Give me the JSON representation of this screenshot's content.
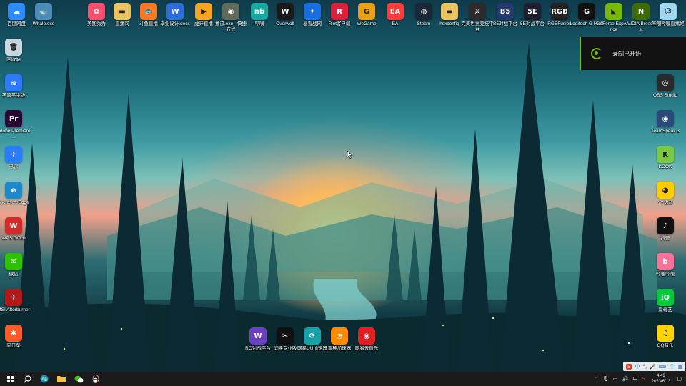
{
  "notification": {
    "text": "录制已开始"
  },
  "tray": {
    "ime_indicator": "中",
    "time": "4:49",
    "date": "2023/6/13"
  },
  "ime_toolbar": {
    "logo": "S",
    "mode": "中"
  },
  "taskbar": {
    "apps": [
      "start",
      "search",
      "edge",
      "file-explorer",
      "wechat",
      "qq"
    ]
  },
  "desktop": {
    "top_row": [
      {
        "label": "百度网盘",
        "icon": "baidu-netdisk-icon",
        "color": "#2f8cff",
        "glyph": "☁"
      },
      {
        "label": "Whale.exe",
        "icon": "whale-icon",
        "color": "#4a8bb8",
        "glyph": "🐋"
      },
      {
        "label": "美图秀秀",
        "icon": "meitu-icon",
        "color": "#ff4d6d",
        "glyph": "✿"
      },
      {
        "label": "直播间",
        "icon": "folder-icon",
        "color": "#e9c463",
        "glyph": "▬"
      },
      {
        "label": "斗鱼直播",
        "icon": "douyu-icon",
        "color": "#ff7a22",
        "glyph": "🐟"
      },
      {
        "label": "毕业设计.docx",
        "icon": "word-doc-icon",
        "color": "#2b6dd6",
        "glyph": "W"
      },
      {
        "label": "虎牙直播",
        "icon": "huya-icon",
        "color": "#f7a520",
        "glyph": "▶"
      },
      {
        "label": "播流.exe - 快捷方式",
        "icon": "app-exe-icon",
        "color": "#5f6a5a",
        "glyph": "◉"
      },
      {
        "label": "哔嘀",
        "icon": "bidi-icon",
        "color": "#18a8a0",
        "glyph": "nb"
      },
      {
        "label": "Overwolf",
        "icon": "overwolf-icon",
        "color": "#1a1a1a",
        "glyph": "W"
      },
      {
        "label": "暴雪战网",
        "icon": "battlenet-icon",
        "color": "#1a6fe0",
        "glyph": "✦"
      },
      {
        "label": "Riot客户端",
        "icon": "riot-icon",
        "color": "#d6223a",
        "glyph": "R"
      },
      {
        "label": "WeGame",
        "icon": "wegame-icon",
        "color": "#e8a21a",
        "glyph": "G"
      },
      {
        "label": "EA",
        "icon": "ea-icon",
        "color": "#ff3b3b",
        "glyph": "EA"
      },
      {
        "label": "Steam",
        "icon": "steam-icon",
        "color": "#1b2838",
        "glyph": "◍"
      },
      {
        "label": "hsxconfig",
        "icon": "folder-icon",
        "color": "#e9c463",
        "glyph": "▬"
      },
      {
        "label": "完美世界竞技平台",
        "icon": "perfect-world-icon",
        "color": "#2b2b2b",
        "glyph": "⚔"
      },
      {
        "label": "B5对战平台",
        "icon": "b5-icon",
        "color": "#243a6e",
        "glyph": "B5"
      },
      {
        "label": "5E对战平台",
        "icon": "5e-icon",
        "color": "#1e1e2e",
        "glyph": "5E"
      },
      {
        "label": "RGBFusion",
        "icon": "rgbfusion-icon",
        "color": "#222222",
        "glyph": "RGB"
      },
      {
        "label": "Logitech G HUB",
        "icon": "logitech-icon",
        "color": "#111111",
        "glyph": "G"
      },
      {
        "label": "GeForce Experience",
        "icon": "geforce-icon",
        "color": "#76b900",
        "glyph": "◣"
      },
      {
        "label": "NVIDIA Broadcast",
        "icon": "nvidia-broadcast-icon",
        "color": "#3d6b00",
        "glyph": "N"
      },
      {
        "label": "哔哩哔哩直播姬",
        "icon": "bilibili-live-icon",
        "color": "#9fd7f0",
        "glyph": "☺"
      }
    ],
    "left_column": [
      {
        "label": "回收站",
        "icon": "recycle-bin-icon",
        "color": "#c8d6e0",
        "glyph": "🗑"
      },
      {
        "label": "学浪学生版",
        "icon": "xuelang-icon",
        "color": "#2f7bff",
        "glyph": "≋"
      },
      {
        "label": "Adobe Premiere ...",
        "icon": "premiere-icon",
        "color": "#2a0634",
        "glyph": "Pr"
      },
      {
        "label": "迅雷",
        "icon": "xunlei-icon",
        "color": "#2a7cff",
        "glyph": "✈"
      },
      {
        "label": "Microsoft Edge",
        "icon": "edge-icon",
        "color": "#1e88c8",
        "glyph": "e"
      },
      {
        "label": "WPS Office",
        "icon": "wps-icon",
        "color": "#d42a2a",
        "glyph": "W"
      },
      {
        "label": "微信",
        "icon": "wechat-icon",
        "color": "#2dc100",
        "glyph": "✉"
      },
      {
        "label": "MSI Afterburner",
        "icon": "afterburner-icon",
        "color": "#b01a1a",
        "glyph": "✈"
      },
      {
        "label": "向日葵",
        "icon": "sunflower-icon",
        "color": "#ff5a2a",
        "glyph": "✱"
      }
    ],
    "right_column": [
      {
        "label": "OBS Studio",
        "icon": "obs-icon",
        "color": "#2a2a2a",
        "glyph": "◎"
      },
      {
        "label": "TeamSpeak 3",
        "icon": "teamspeak-icon",
        "color": "#2a4a7a",
        "glyph": "◉"
      },
      {
        "label": "KOOK",
        "icon": "kook-icon",
        "color": "#7ac943",
        "glyph": "K"
      },
      {
        "label": "YY语音",
        "icon": "yy-icon",
        "color": "#ffcc00",
        "glyph": "◕"
      },
      {
        "label": "抖音",
        "icon": "douyin-icon",
        "color": "#111111",
        "glyph": "♪"
      },
      {
        "label": "哔哩哔哩",
        "icon": "bilibili-icon",
        "color": "#fb7299",
        "glyph": "b"
      },
      {
        "label": "爱奇艺",
        "icon": "iqiyi-icon",
        "color": "#00c93c",
        "glyph": "iQ"
      },
      {
        "label": "QQ音乐",
        "icon": "qqmusic-icon",
        "color": "#ffd200",
        "glyph": "♫"
      }
    ],
    "bottom_row": [
      {
        "label": "RO对战平台",
        "icon": "ro-icon",
        "color": "#6b3fbf",
        "glyph": "W"
      },
      {
        "label": "剪映专业版",
        "icon": "jianying-icon",
        "color": "#111111",
        "glyph": "✂"
      },
      {
        "label": "网易UU加速器",
        "icon": "uu-icon",
        "color": "#17a0a8",
        "glyph": "⟳"
      },
      {
        "label": "雷神加速器",
        "icon": "leishen-icon",
        "color": "#ff8a00",
        "glyph": "◔"
      },
      {
        "label": "网易云音乐",
        "icon": "netease-music-icon",
        "color": "#e02020",
        "glyph": "◉"
      }
    ]
  }
}
